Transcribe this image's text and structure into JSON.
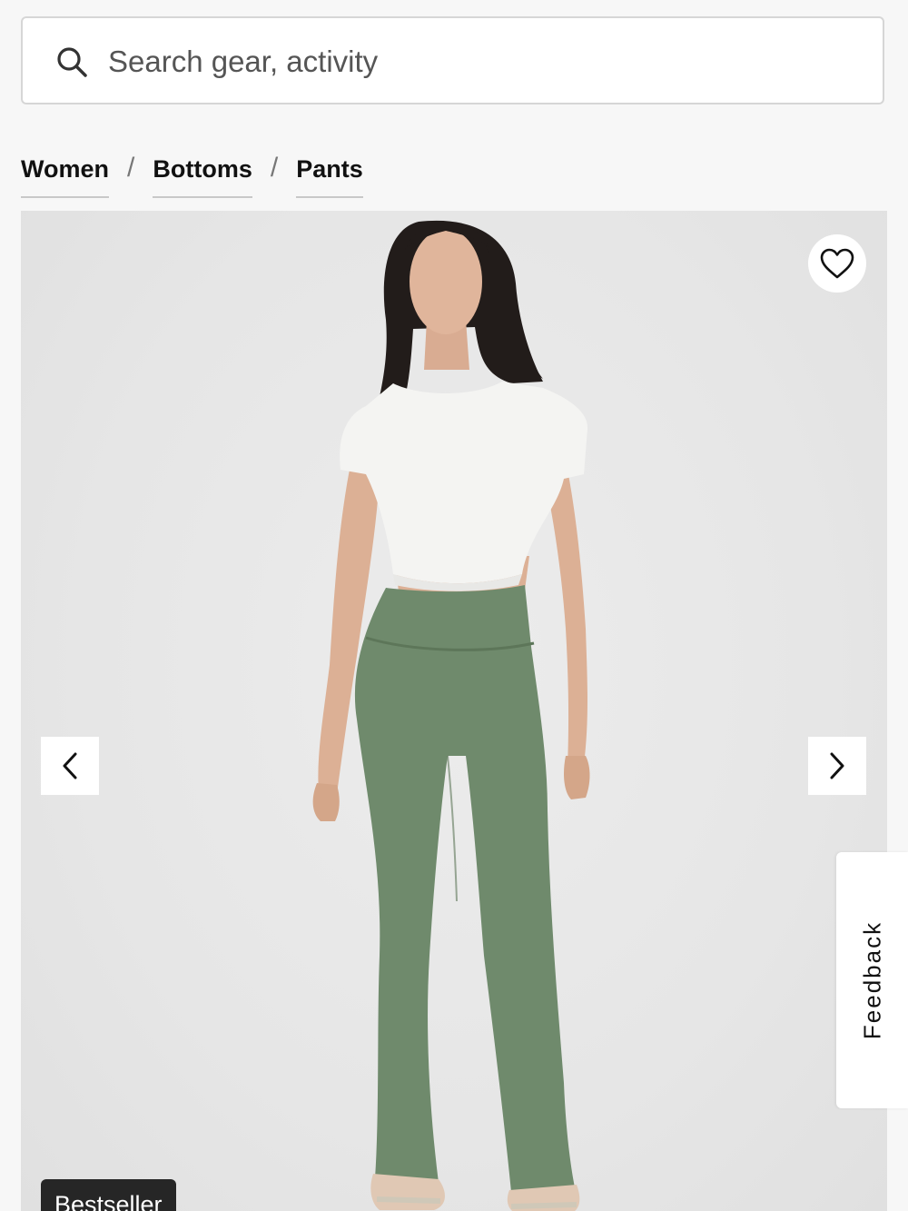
{
  "search": {
    "placeholder": "Search gear, activity",
    "icon": "search-icon"
  },
  "breadcrumb": {
    "items": [
      "Women",
      "Bottoms",
      "Pants"
    ],
    "separator": "/"
  },
  "product_image": {
    "wishlist_icon": "heart-outline-icon",
    "prev_icon": "chevron-left-icon",
    "next_icon": "chevron-right-icon",
    "badge": "Bestseller",
    "colors": {
      "pants": "#6f8a6c",
      "top": "#f4f4f2",
      "background": "#e6e6e6"
    }
  },
  "feedback": {
    "label": "Feedback"
  }
}
